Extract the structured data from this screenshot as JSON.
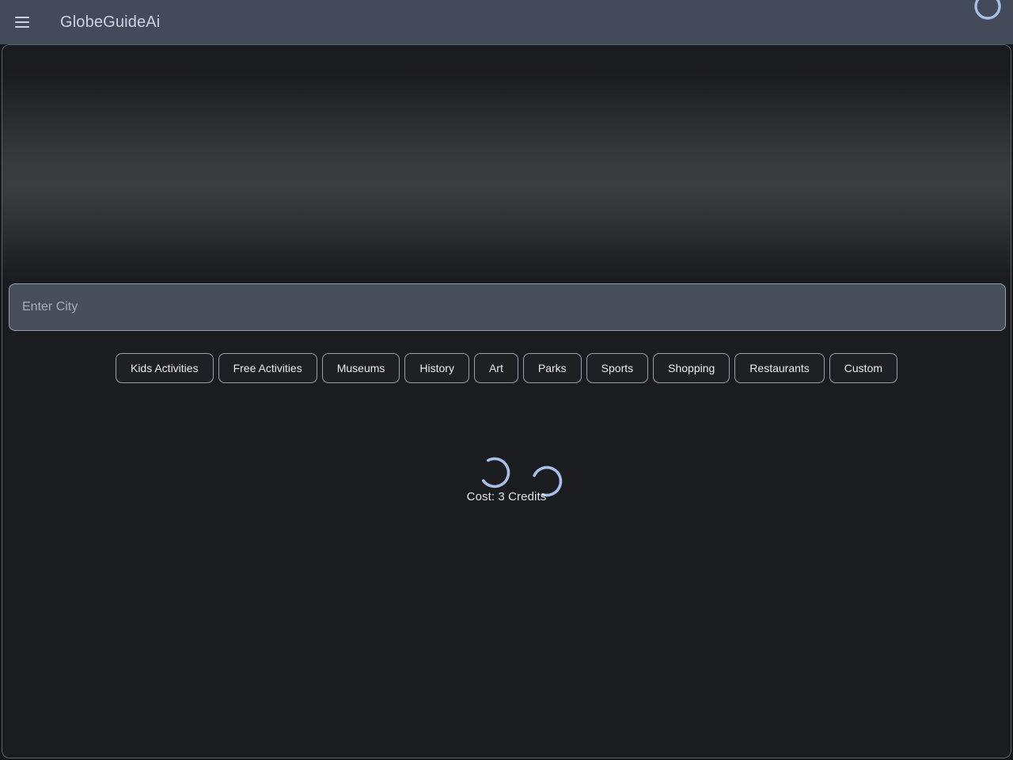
{
  "header": {
    "menu_icon": "hamburger-menu-icon",
    "title": "GlobeGuideAi",
    "spinner_icon": "loading-spinner-icon"
  },
  "hero": {
    "type": "gradient-banner",
    "has_image": false
  },
  "search": {
    "value": "",
    "placeholder": "Enter City"
  },
  "categories": [
    {
      "label": "Kids Activities"
    },
    {
      "label": "Free Activities"
    },
    {
      "label": "Museums"
    },
    {
      "label": "History"
    },
    {
      "label": "Art"
    },
    {
      "label": "Parks"
    },
    {
      "label": "Sports"
    },
    {
      "label": "Shopping"
    },
    {
      "label": "Restaurants"
    },
    {
      "label": "Custom"
    }
  ],
  "loading": {
    "primary_spinner_icon": "loading-spinner-icon",
    "secondary_spinner_icon": "loading-spinner-icon",
    "cost_text": "Cost: 3 Credits"
  },
  "colors": {
    "app_bar": "#434a5a",
    "page_background": "#1b1c1f",
    "spinner_accent": "#a6c0e8",
    "input_background": "#474e5c",
    "border": "#9aa0ab",
    "text_primary": "#edeef2",
    "text_muted": "#a8adb8"
  }
}
